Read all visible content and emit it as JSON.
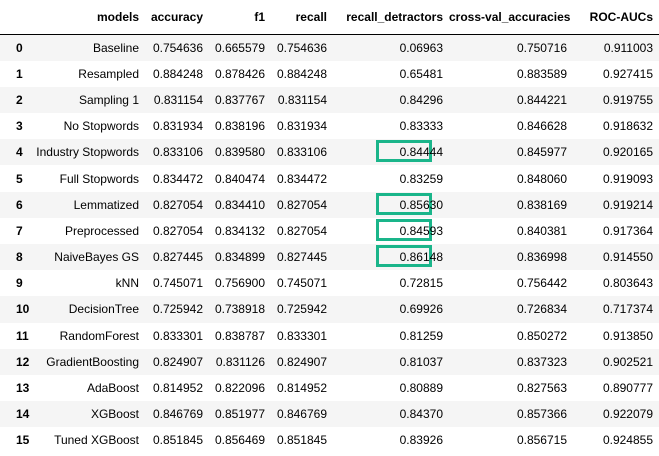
{
  "table": {
    "index_header": "",
    "columns": [
      "models",
      "accuracy",
      "f1",
      "recall",
      "recall_detractors",
      "cross-val_accuracies",
      "ROC-AUCs"
    ],
    "rows": [
      {
        "index": "0",
        "models": "Baseline",
        "accuracy": "0.754636",
        "f1": "0.665579",
        "recall": "0.754636",
        "recall_detractors": "0.06963",
        "cv": "0.750716",
        "roc": "0.911003",
        "highlight": false
      },
      {
        "index": "1",
        "models": "Resampled",
        "accuracy": "0.884248",
        "f1": "0.878426",
        "recall": "0.884248",
        "recall_detractors": "0.65481",
        "cv": "0.883589",
        "roc": "0.927415",
        "highlight": false
      },
      {
        "index": "2",
        "models": "Sampling 1",
        "accuracy": "0.831154",
        "f1": "0.837767",
        "recall": "0.831154",
        "recall_detractors": "0.84296",
        "cv": "0.844221",
        "roc": "0.919755",
        "highlight": false
      },
      {
        "index": "3",
        "models": "No Stopwords",
        "accuracy": "0.831934",
        "f1": "0.838196",
        "recall": "0.831934",
        "recall_detractors": "0.83333",
        "cv": "0.846628",
        "roc": "0.918632",
        "highlight": false
      },
      {
        "index": "4",
        "models": "Industry Stopwords",
        "accuracy": "0.833106",
        "f1": "0.839580",
        "recall": "0.833106",
        "recall_detractors": "0.84444",
        "cv": "0.845977",
        "roc": "0.920165",
        "highlight": true
      },
      {
        "index": "5",
        "models": "Full Stopwords",
        "accuracy": "0.834472",
        "f1": "0.840474",
        "recall": "0.834472",
        "recall_detractors": "0.83259",
        "cv": "0.848060",
        "roc": "0.919093",
        "highlight": false
      },
      {
        "index": "6",
        "models": "Lemmatized",
        "accuracy": "0.827054",
        "f1": "0.834410",
        "recall": "0.827054",
        "recall_detractors": "0.85630",
        "cv": "0.838169",
        "roc": "0.919214",
        "highlight": true
      },
      {
        "index": "7",
        "models": "Preprocessed",
        "accuracy": "0.827054",
        "f1": "0.834132",
        "recall": "0.827054",
        "recall_detractors": "0.84593",
        "cv": "0.840381",
        "roc": "0.917364",
        "highlight": true
      },
      {
        "index": "8",
        "models": "NaiveBayes GS",
        "accuracy": "0.827445",
        "f1": "0.834899",
        "recall": "0.827445",
        "recall_detractors": "0.86148",
        "cv": "0.836998",
        "roc": "0.914550",
        "highlight": true
      },
      {
        "index": "9",
        "models": "kNN",
        "accuracy": "0.745071",
        "f1": "0.756900",
        "recall": "0.745071",
        "recall_detractors": "0.72815",
        "cv": "0.756442",
        "roc": "0.803643",
        "highlight": false
      },
      {
        "index": "10",
        "models": "DecisionTree",
        "accuracy": "0.725942",
        "f1": "0.738918",
        "recall": "0.725942",
        "recall_detractors": "0.69926",
        "cv": "0.726834",
        "roc": "0.717374",
        "highlight": false
      },
      {
        "index": "11",
        "models": "RandomForest",
        "accuracy": "0.833301",
        "f1": "0.838787",
        "recall": "0.833301",
        "recall_detractors": "0.81259",
        "cv": "0.850272",
        "roc": "0.913850",
        "highlight": false
      },
      {
        "index": "12",
        "models": "GradientBoosting",
        "accuracy": "0.824907",
        "f1": "0.831126",
        "recall": "0.824907",
        "recall_detractors": "0.81037",
        "cv": "0.837323",
        "roc": "0.902521",
        "highlight": false
      },
      {
        "index": "13",
        "models": "AdaBoost",
        "accuracy": "0.814952",
        "f1": "0.822096",
        "recall": "0.814952",
        "recall_detractors": "0.80889",
        "cv": "0.827563",
        "roc": "0.890777",
        "highlight": false
      },
      {
        "index": "14",
        "models": "XGBoost",
        "accuracy": "0.846769",
        "f1": "0.851977",
        "recall": "0.846769",
        "recall_detractors": "0.84370",
        "cv": "0.857366",
        "roc": "0.922079",
        "highlight": false
      },
      {
        "index": "15",
        "models": "Tuned XGBoost",
        "accuracy": "0.851845",
        "f1": "0.856469",
        "recall": "0.851845",
        "recall_detractors": "0.83926",
        "cv": "0.856715",
        "roc": "0.924855",
        "highlight": false
      }
    ],
    "highlight_color": "#1ab58a",
    "stripe_color": "#f5f5f5"
  }
}
